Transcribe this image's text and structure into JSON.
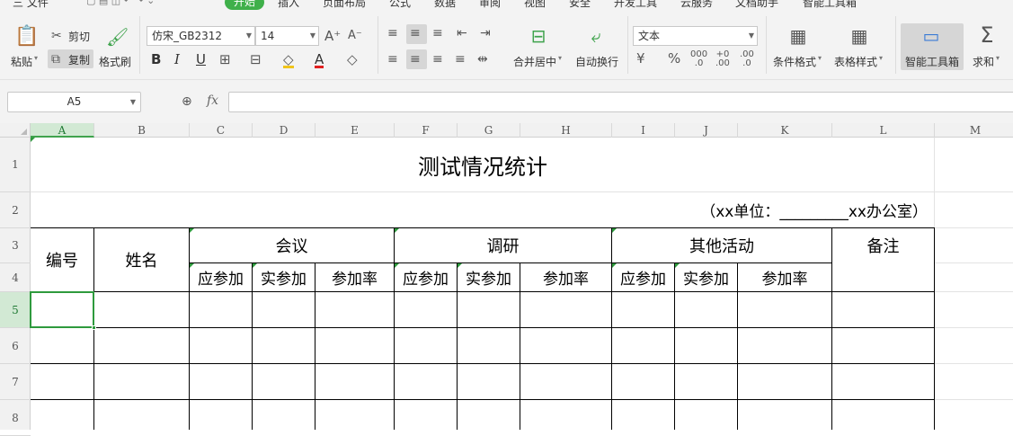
{
  "menu": {
    "items": [
      "三 文件",
      "开始",
      "插入",
      "页面布局",
      "公式",
      "数据",
      "审阅",
      "视图",
      "安全",
      "开发工具",
      "云服务",
      "文档助手",
      "智能工具箱"
    ]
  },
  "ribbon": {
    "paste": "粘贴",
    "cut": "剪切",
    "copy": "复制",
    "format_painter": "格式刷",
    "font_name": "仿宋_GB2312",
    "font_size": "14",
    "merge_center": "合并居中",
    "wrap_text": "自动换行",
    "number_format": "文本",
    "conditional_format": "条件格式",
    "table_style": "表格样式",
    "smart_toolbox": "智能工具箱",
    "sum": "求和"
  },
  "formula_bar": {
    "name_box": "A5",
    "fx": "fx",
    "content": ""
  },
  "columns": [
    "A",
    "B",
    "C",
    "D",
    "E",
    "F",
    "G",
    "H",
    "I",
    "J",
    "K",
    "L",
    "M"
  ],
  "rows": [
    "1",
    "2",
    "3",
    "4",
    "5",
    "6",
    "7",
    "8"
  ],
  "sheet": {
    "title": "测试情况统计",
    "unit_line": "（xx单位：_________xx办公室）",
    "h_number": "编号",
    "h_name": "姓名",
    "h_meeting": "会议",
    "h_research": "调研",
    "h_other": "其他活动",
    "h_remark": "备注",
    "sub": [
      "应参加",
      "实参加",
      "参加率",
      "应参加",
      "实参加",
      "参加率",
      "应参加",
      "实参加",
      "参加率"
    ]
  },
  "colors": {
    "accent": "#3fb04a",
    "selection": "#2e9a3d"
  }
}
